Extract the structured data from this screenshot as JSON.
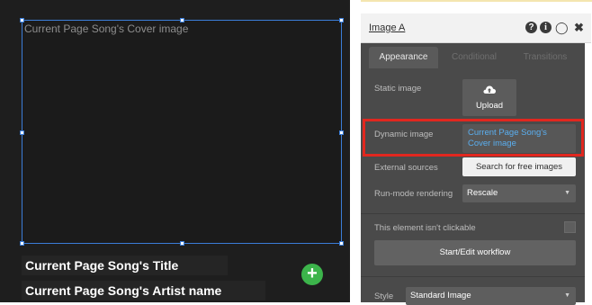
{
  "canvas": {
    "image_placeholder": "Current Page Song's Cover image",
    "title_text": "Current Page Song's Title",
    "artist_text": "Current Page Song's Artist name",
    "add_icon": "plus-circle-icon",
    "accent": "#3b7dd8",
    "add_color": "#3cb44b"
  },
  "panel": {
    "title": "Image A",
    "header_icons": {
      "help": "?",
      "info": "i",
      "comment": "⬭",
      "close": "✖"
    },
    "tabs": [
      {
        "label": "Appearance",
        "active": true
      },
      {
        "label": "Conditional",
        "active": false
      },
      {
        "label": "Transitions",
        "active": false
      }
    ],
    "static_image": {
      "label": "Static image",
      "button": "Upload",
      "icon": "cloud-upload-icon"
    },
    "dynamic_image": {
      "label": "Dynamic image",
      "value": "Current Page Song's Cover image",
      "link_color": "#5aaeef"
    },
    "external_sources": {
      "label": "External sources",
      "button": "Search for free images"
    },
    "run_mode": {
      "label": "Run-mode rendering",
      "value": "Rescale"
    },
    "clickable": {
      "label": "This element isn't clickable",
      "checked": false
    },
    "workflow_button": "Start/Edit workflow",
    "style": {
      "label": "Style",
      "value": "Standard Image"
    },
    "highlight_color": "#e1271f"
  }
}
